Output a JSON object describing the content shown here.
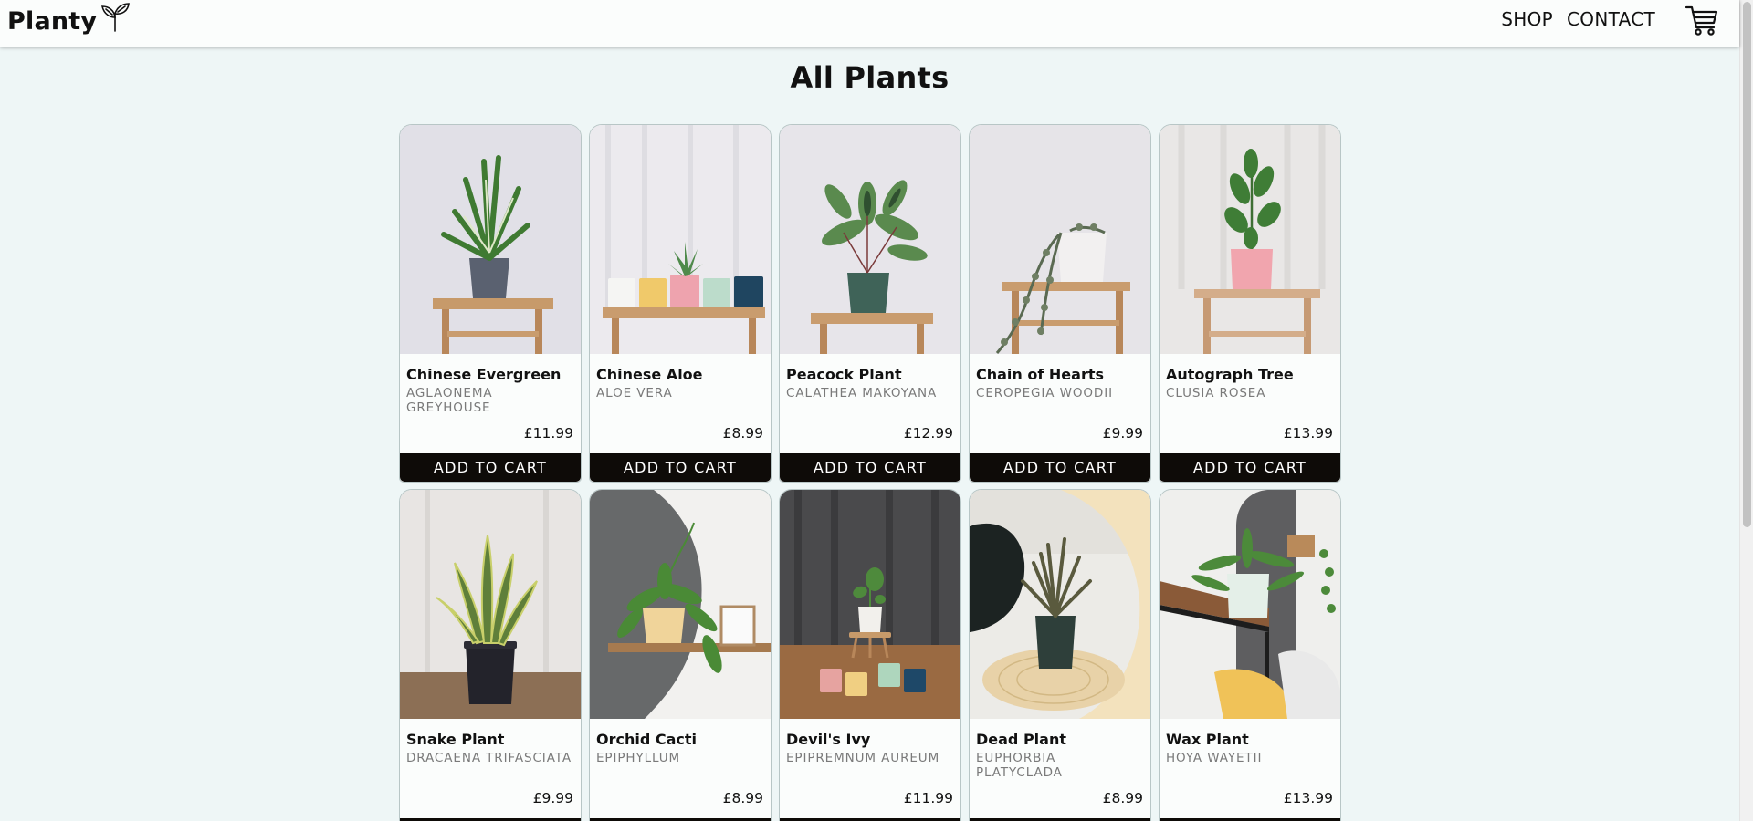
{
  "header": {
    "logo_text": "Planty",
    "logo_icon": "sprout-icon",
    "nav": [
      "SHOP",
      "CONTACT"
    ],
    "cart_icon": "cart-icon"
  },
  "main": {
    "title": "All Plants",
    "add_label": "ADD TO CART",
    "products": [
      {
        "name": "Chinese Evergreen",
        "latin": "AGLAONEMA GREYHOUSE",
        "price": "£11.99"
      },
      {
        "name": "Chinese Aloe",
        "latin": "ALOE VERA",
        "price": "£8.99"
      },
      {
        "name": "Peacock Plant",
        "latin": "CALATHEA MAKOYANA",
        "price": "£12.99"
      },
      {
        "name": "Chain of Hearts",
        "latin": "CEROPEGIA WOODII",
        "price": "£9.99"
      },
      {
        "name": "Autograph Tree",
        "latin": "CLUSIA ROSEA",
        "price": "£13.99"
      },
      {
        "name": "Snake Plant",
        "latin": "DRACAENA TRIFASCIATA",
        "price": "£9.99"
      },
      {
        "name": "Orchid Cacti",
        "latin": "EPIPHYLLUM",
        "price": "£8.99"
      },
      {
        "name": "Devil's Ivy",
        "latin": "EPIPREMNUM AUREUM",
        "price": "£11.99"
      },
      {
        "name": "Dead Plant",
        "latin": "EUPHORBIA PLATYCLADA",
        "price": "£8.99"
      },
      {
        "name": "Wax Plant",
        "latin": "HOYA WAYETII",
        "price": "£13.99"
      }
    ]
  },
  "colors": {
    "page_bg": "#eef6f6",
    "card_bg": "#fbfdfc",
    "button_bg": "#0e0b08",
    "latin_text": "#7a7a7a"
  }
}
